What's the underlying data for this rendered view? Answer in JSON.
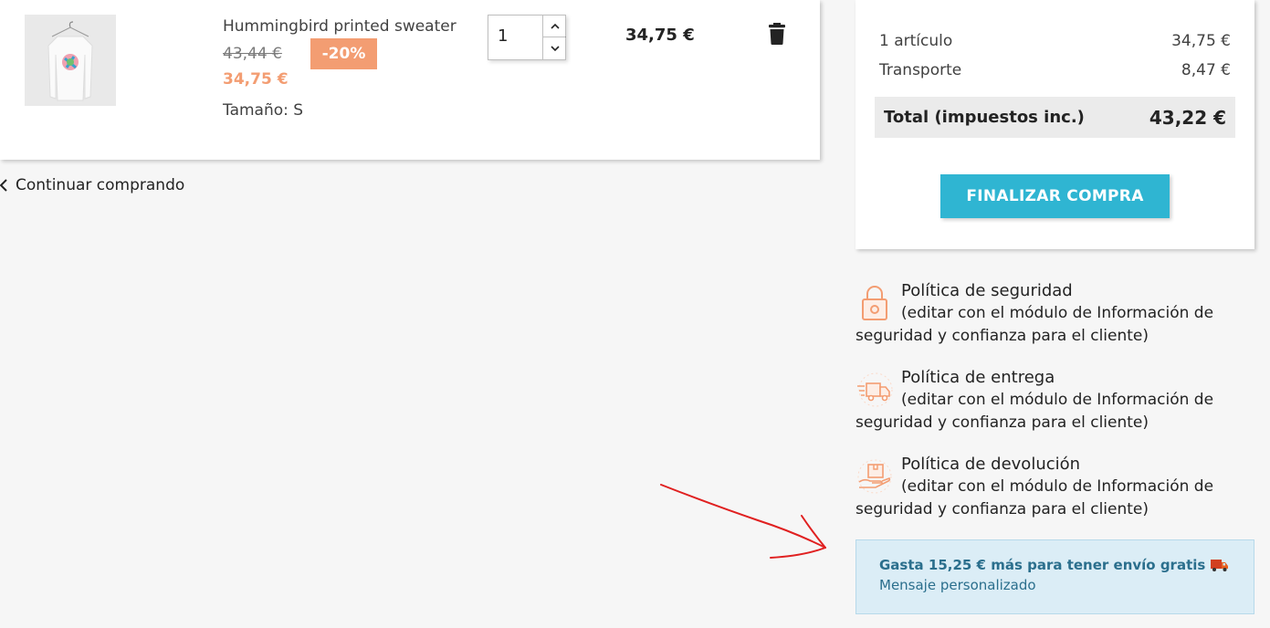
{
  "cart_item": {
    "name": "Hummingbird printed sweater",
    "regular_price": "43,44 €",
    "discount": "-20%",
    "price": "34,75 €",
    "size": "Tamaño: S",
    "quantity": "1",
    "line_total": "34,75 €"
  },
  "continue_shopping": "Continuar comprando",
  "summary": {
    "items_label": "1 artículo",
    "items_value": "34,75 €",
    "shipping_label": "Transporte",
    "shipping_value": "8,47 €",
    "total_label": "Total (impuestos inc.)",
    "total_value": "43,22 €",
    "checkout_label": "FINALIZAR COMPRA"
  },
  "reassurance": [
    {
      "title": "Política de seguridad",
      "desc": "(editar con el módulo de Información de seguridad y confianza para el cliente)",
      "icon": "lock-icon"
    },
    {
      "title": "Política de entrega",
      "desc": "(editar con el módulo de Información de seguridad y confianza para el cliente)",
      "icon": "delivery-truck-icon"
    },
    {
      "title": "Política de devolución",
      "desc": "(editar con el módulo de Información de seguridad y confianza para el cliente)",
      "icon": "return-package-icon"
    }
  ],
  "free_shipping": {
    "message": "Gasta 15,25 € más para tener envío gratis",
    "custom_message": "Mensaje personalizado"
  },
  "colors": {
    "accent": "#2fb5d2",
    "discount": "#f39d72",
    "annotation": "#e02020",
    "notice_bg": "#dbedf6"
  }
}
